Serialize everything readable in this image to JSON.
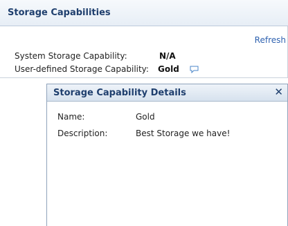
{
  "panel": {
    "title": "Storage Capabilities",
    "refresh_label": "Refresh",
    "system_label": "System Storage Capability:",
    "system_value": "N/A",
    "user_label": "User-defined Storage Capability:",
    "user_value": "Gold",
    "user_icon": "comment-icon"
  },
  "dialog": {
    "title": "Storage Capability Details",
    "close_glyph": "✕",
    "name_label": "Name:",
    "name_value": "Gold",
    "description_label": "Description:",
    "description_value": "Best Storage we have!"
  },
  "colors": {
    "title": "#1f3f6e",
    "link": "#2f62b0",
    "border": "#8fa3bb"
  }
}
